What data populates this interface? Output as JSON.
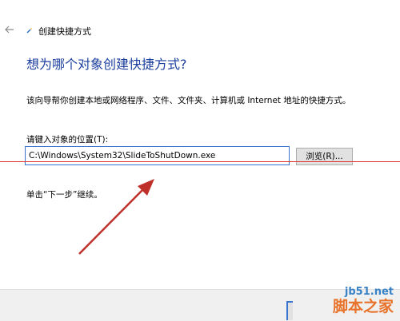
{
  "window": {
    "title": "创建快捷方式",
    "back_icon": "arrow-left-icon"
  },
  "main": {
    "heading": "想为哪个对象创建快捷方式?",
    "description": "该向导帮你创建本地或网络程序、文件、文件夹、计算机或 Internet 地址的快捷方式。",
    "location_label": "请键入对象的位置(T):",
    "location_value": "C:\\Windows\\System32\\SlideToShutDown.exe",
    "browse_label": "浏览(R)...",
    "hint": "单击“下一步”继续。"
  },
  "watermark": {
    "url": "jb51.net",
    "name": "脚本之家"
  },
  "colors": {
    "heading": "#1c3f9f",
    "annotation": "#e0342a",
    "focus_border": "#3a74d1"
  }
}
